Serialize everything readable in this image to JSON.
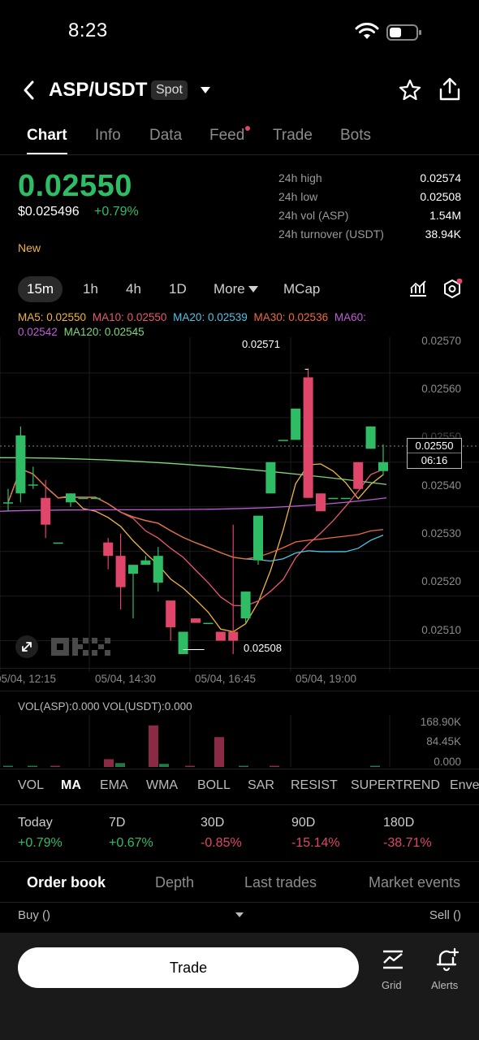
{
  "status_bar": {
    "time": "8:23"
  },
  "header": {
    "pair": "ASP/USDT",
    "market_type": "Spot"
  },
  "tabs": [
    "Chart",
    "Info",
    "Data",
    "Feed",
    "Trade",
    "Bots"
  ],
  "ticker": {
    "price": "0.02550",
    "usd_price": "$0.025496",
    "change": "+0.79%",
    "tag": "New",
    "stats": [
      {
        "label": "24h high",
        "value": "0.02574"
      },
      {
        "label": "24h low",
        "value": "0.02508"
      },
      {
        "label": "24h vol (ASP)",
        "value": "1.54M"
      },
      {
        "label": "24h turnover (USDT)",
        "value": "38.94K"
      }
    ]
  },
  "timeframes": {
    "items": [
      "15m",
      "1h",
      "4h",
      "1D"
    ],
    "more": "More",
    "mcap": "MCap"
  },
  "ma_legend": [
    {
      "text": "MA5: 0.02550",
      "color": "#f0b43c"
    },
    {
      "text": "MA10: 0.02550",
      "color": "#e8586f"
    },
    {
      "text": "MA20: 0.02539",
      "color": "#4fc3e6"
    },
    {
      "text": "MA30: 0.02536",
      "color": "#ef6a3c"
    },
    {
      "text": "MA60: 0.02542",
      "color": "#c05bd8"
    },
    {
      "text": "MA120: 0.02545",
      "color": "#7dd87a"
    }
  ],
  "chart_data": {
    "type": "candlestick",
    "y_ticks": [
      "0.02570",
      "0.02560",
      "0.02550",
      "0.02540",
      "0.02530",
      "0.02520",
      "0.02510"
    ],
    "x_ticks": [
      "05/04, 12:15",
      "05/04, 14:30",
      "05/04, 16:45",
      "05/04, 19:00"
    ],
    "high_label": "0.02571",
    "low_label": "0.02508",
    "current_price": "0.02550",
    "countdown": "06:16",
    "up_color": "#2ebd65",
    "down_color": "#e0456a",
    "ylim": [
      0.02503,
      0.02578
    ],
    "candles": [
      {
        "o": 0.02541,
        "h": 0.02544,
        "l": 0.02539,
        "c": 0.02541
      },
      {
        "o": 0.02543,
        "h": 0.02558,
        "l": 0.02541,
        "c": 0.02556
      },
      {
        "o": 0.02545,
        "h": 0.02549,
        "l": 0.02544,
        "c": 0.02545
      },
      {
        "o": 0.02542,
        "h": 0.02546,
        "l": 0.02533,
        "c": 0.02536
      },
      {
        "o": 0.02532,
        "h": 0.02532,
        "l": 0.02532,
        "c": 0.02532
      },
      {
        "o": 0.02541,
        "h": 0.02543,
        "l": 0.0254,
        "c": 0.02543
      },
      {
        "o": 0.02542,
        "h": 0.02542,
        "l": 0.02542,
        "c": 0.02542
      },
      {
        "o": 0.02542,
        "h": 0.02542,
        "l": 0.02542,
        "c": 0.02542
      },
      {
        "o": 0.02532,
        "h": 0.02533,
        "l": 0.02526,
        "c": 0.02529
      },
      {
        "o": 0.02529,
        "h": 0.02534,
        "l": 0.02517,
        "c": 0.02522
      },
      {
        "o": 0.02525,
        "h": 0.02527,
        "l": 0.02515,
        "c": 0.02527
      },
      {
        "o": 0.02527,
        "h": 0.02529,
        "l": 0.02527,
        "c": 0.02528
      },
      {
        "o": 0.02523,
        "h": 0.02531,
        "l": 0.02521,
        "c": 0.02529
      },
      {
        "o": 0.02519,
        "h": 0.02519,
        "l": 0.0251,
        "c": 0.02513
      },
      {
        "o": 0.02507,
        "h": 0.02512,
        "l": 0.02507,
        "c": 0.02512
      },
      {
        "o": 0.02515,
        "h": 0.02515,
        "l": 0.02514,
        "c": 0.02514
      },
      {
        "o": 0.02514,
        "h": 0.02514,
        "l": 0.02514,
        "c": 0.02514
      },
      {
        "o": 0.02512,
        "h": 0.02512,
        "l": 0.0251,
        "c": 0.0251
      },
      {
        "o": 0.02512,
        "h": 0.02536,
        "l": 0.02507,
        "c": 0.0251
      },
      {
        "o": 0.02515,
        "h": 0.02521,
        "l": 0.02514,
        "c": 0.02521
      },
      {
        "o": 0.02528,
        "h": 0.02538,
        "l": 0.02527,
        "c": 0.02538
      },
      {
        "o": 0.02543,
        "h": 0.0255,
        "l": 0.02543,
        "c": 0.0255
      },
      {
        "o": 0.02555,
        "h": 0.02555,
        "l": 0.02555,
        "c": 0.02555
      },
      {
        "o": 0.02555,
        "h": 0.02562,
        "l": 0.02555,
        "c": 0.02562
      },
      {
        "o": 0.02569,
        "h": 0.02571,
        "l": 0.02542,
        "c": 0.02542
      },
      {
        "o": 0.02543,
        "h": 0.02543,
        "l": 0.02539,
        "c": 0.02539
      },
      {
        "o": 0.02542,
        "h": 0.02542,
        "l": 0.02542,
        "c": 0.02542
      },
      {
        "o": 0.02542,
        "h": 0.02542,
        "l": 0.02542,
        "c": 0.02542
      },
      {
        "o": 0.0255,
        "h": 0.0255,
        "l": 0.02544,
        "c": 0.02544
      },
      {
        "o": 0.02553,
        "h": 0.02558,
        "l": 0.02553,
        "c": 0.02558
      },
      {
        "o": 0.02548,
        "h": 0.02554,
        "l": 0.02547,
        "c": 0.0255
      }
    ],
    "volume": {
      "legend": "VOL(ASP):0.000  VOL(USDT):0.000",
      "ticks": [
        "168.90K",
        "84.45K",
        "0.000"
      ],
      "ylim": [
        0,
        200000
      ],
      "bars": [
        {
          "v": 2000,
          "up": true
        },
        {
          "v": 1500,
          "up": true
        },
        {
          "v": 2500,
          "up": false
        },
        {
          "v": 30000,
          "up": false
        },
        {
          "v": 15000,
          "up": true
        },
        {
          "v": 160000,
          "up": false
        },
        {
          "v": 12000,
          "up": true
        },
        {
          "v": 1000,
          "up": false
        },
        {
          "v": 115000,
          "up": false
        },
        {
          "v": 2000,
          "up": true
        },
        {
          "v": 1000,
          "up": false
        },
        {
          "v": 3000,
          "up": true
        }
      ]
    }
  },
  "indicators": [
    "VOL",
    "MA",
    "EMA",
    "WMA",
    "BOLL",
    "SAR",
    "RESIST",
    "SUPERTREND",
    "Enve"
  ],
  "performance": [
    {
      "label": "Today",
      "value": "+0.79%",
      "color": "#2ebd65"
    },
    {
      "label": "7D",
      "value": "+0.67%",
      "color": "#2ebd65"
    },
    {
      "label": "30D",
      "value": "-0.85%",
      "color": "#e0456a"
    },
    {
      "label": "90D",
      "value": "-15.14%",
      "color": "#e0456a"
    },
    {
      "label": "180D",
      "value": "-38.71%",
      "color": "#e0456a"
    }
  ],
  "orderbook": {
    "tabs": [
      "Order book",
      "Depth",
      "Last trades",
      "Market events"
    ],
    "buy": "Buy ()",
    "sell": "Sell ()"
  },
  "bottom_bar": {
    "trade": "Trade",
    "grid": "Grid",
    "alerts": "Alerts"
  }
}
